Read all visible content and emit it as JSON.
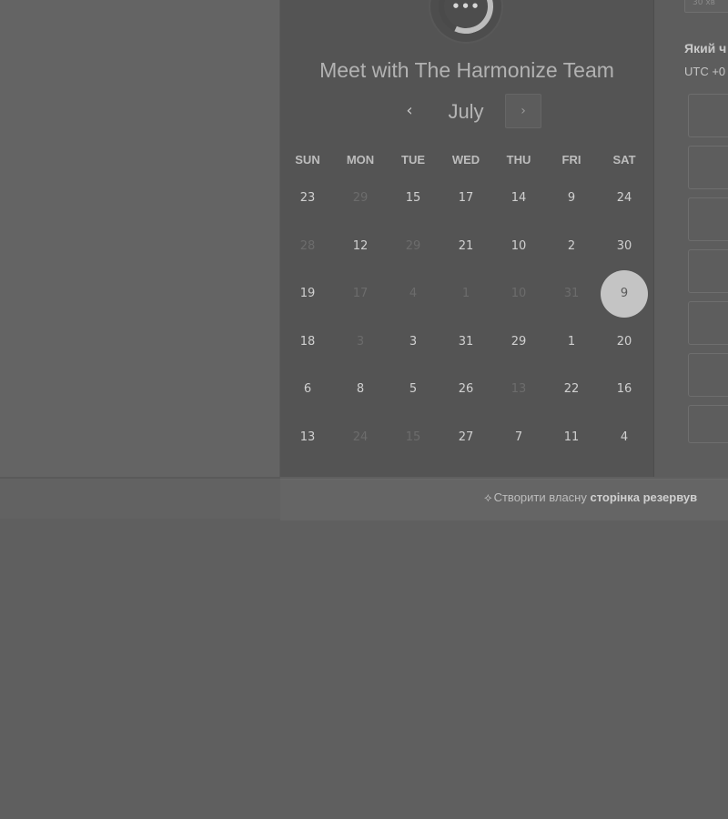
{
  "calendar": {
    "title": "Meet with The Harmonize Team",
    "month": "July",
    "prev_glyph": "‹",
    "next_glyph": "›",
    "avatar_dots": "•••",
    "weekdays": [
      "SUN",
      "MON",
      "TUE",
      "WED",
      "THU",
      "FRI",
      "SAT"
    ],
    "weeks": [
      [
        {
          "d": "23",
          "m": false
        },
        {
          "d": "29",
          "m": true
        },
        {
          "d": "15",
          "m": false
        },
        {
          "d": "17",
          "m": false
        },
        {
          "d": "14",
          "m": false
        },
        {
          "d": "9",
          "m": false
        },
        {
          "d": "24",
          "m": false
        }
      ],
      [
        {
          "d": "28",
          "m": true
        },
        {
          "d": "12",
          "m": false
        },
        {
          "d": "29",
          "m": true
        },
        {
          "d": "21",
          "m": false
        },
        {
          "d": "10",
          "m": false
        },
        {
          "d": "2",
          "m": false
        },
        {
          "d": "30",
          "m": false
        }
      ],
      [
        {
          "d": "19",
          "m": false
        },
        {
          "d": "17",
          "m": true
        },
        {
          "d": "4",
          "m": true
        },
        {
          "d": "1",
          "m": true
        },
        {
          "d": "10",
          "m": true
        },
        {
          "d": "31",
          "m": true
        },
        {
          "d": "9",
          "m": false,
          "selected": true
        }
      ],
      [
        {
          "d": "18",
          "m": false
        },
        {
          "d": "3",
          "m": true
        },
        {
          "d": "3",
          "m": false
        },
        {
          "d": "31",
          "m": false
        },
        {
          "d": "29",
          "m": false
        },
        {
          "d": "1",
          "m": false
        },
        {
          "d": "20",
          "m": false
        }
      ],
      [
        {
          "d": "6",
          "m": false
        },
        {
          "d": "8",
          "m": false
        },
        {
          "d": "5",
          "m": false
        },
        {
          "d": "26",
          "m": false
        },
        {
          "d": "13",
          "m": true
        },
        {
          "d": "22",
          "m": false
        },
        {
          "d": "16",
          "m": false
        }
      ],
      [
        {
          "d": "13",
          "m": false
        },
        {
          "d": "24",
          "m": true
        },
        {
          "d": "15",
          "m": true
        },
        {
          "d": "27",
          "m": false
        },
        {
          "d": "7",
          "m": false
        },
        {
          "d": "11",
          "m": false
        },
        {
          "d": "4",
          "m": false
        }
      ]
    ]
  },
  "right_panel": {
    "top_button": "30 хв",
    "title": "Який ч",
    "timezone": "UTC +0",
    "slot_count": 7
  },
  "footer": {
    "prefix": "Створити власну ",
    "bold": "сторінка резервув"
  },
  "colors": {
    "overlay_gray": "#5f5f5f",
    "panel_gray": "#545454",
    "selected_day": "#c4c4c4"
  }
}
